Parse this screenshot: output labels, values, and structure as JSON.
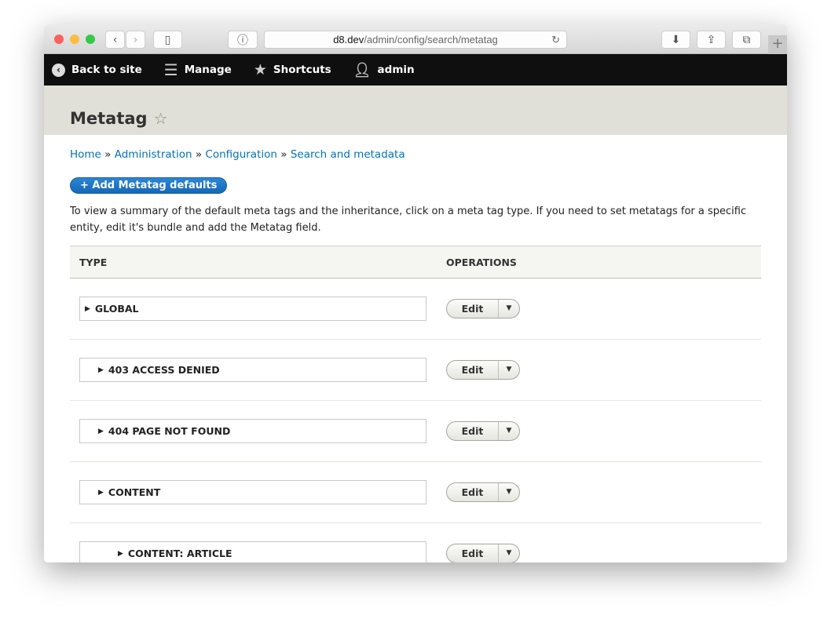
{
  "browser": {
    "url_host": "d8.dev",
    "url_path": "/admin/config/search/metatag"
  },
  "toolbar": {
    "back": "Back to site",
    "manage": "Manage",
    "shortcuts": "Shortcuts",
    "user": "admin"
  },
  "page": {
    "title": "Metatag"
  },
  "breadcrumb": [
    "Home",
    "Administration",
    "Configuration",
    "Search and metadata"
  ],
  "breadcrumb_sep": "»",
  "add_button": "+ Add Metatag defaults",
  "description": "To view a summary of the default meta tags and the inheritance, click on a meta tag type. If you need to set metatags for a specific entity, edit it's bundle and add the Metatag field.",
  "table": {
    "headers": [
      "TYPE",
      "OPERATIONS"
    ],
    "rows": [
      {
        "label": "GLOBAL",
        "level": 0
      },
      {
        "label": "403 ACCESS DENIED",
        "level": 1
      },
      {
        "label": "404 PAGE NOT FOUND",
        "level": 1
      },
      {
        "label": "CONTENT",
        "level": 1
      },
      {
        "label": "CONTENT: ARTICLE",
        "level": 2
      }
    ],
    "edit_label": "Edit"
  },
  "colors": {
    "accent": "#0074bd",
    "toolbar": "#0f0f0f",
    "header": "#e0e0d8"
  }
}
